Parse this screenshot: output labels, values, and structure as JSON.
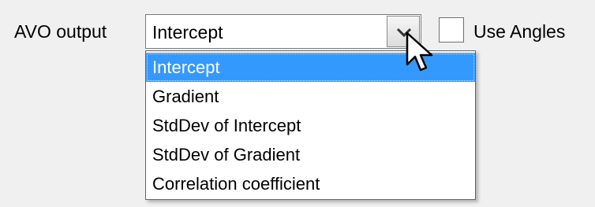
{
  "avo_output": {
    "label": "AVO output",
    "selected_value": "Intercept",
    "options": [
      "Intercept",
      "Gradient",
      "StdDev of Intercept",
      "StdDev of Gradient",
      "Correlation coefficient"
    ],
    "highlighted_option": "Intercept",
    "expanded": true
  },
  "use_angles": {
    "label": "Use Angles",
    "checked": false
  },
  "icons": {
    "dropdown_arrow": "chevron-down-icon",
    "cursor": "mouse-pointer-icon"
  },
  "colors": {
    "window_background": "#f0f0f0",
    "selection_highlight": "#3399ff",
    "selection_text": "#ffffff"
  }
}
